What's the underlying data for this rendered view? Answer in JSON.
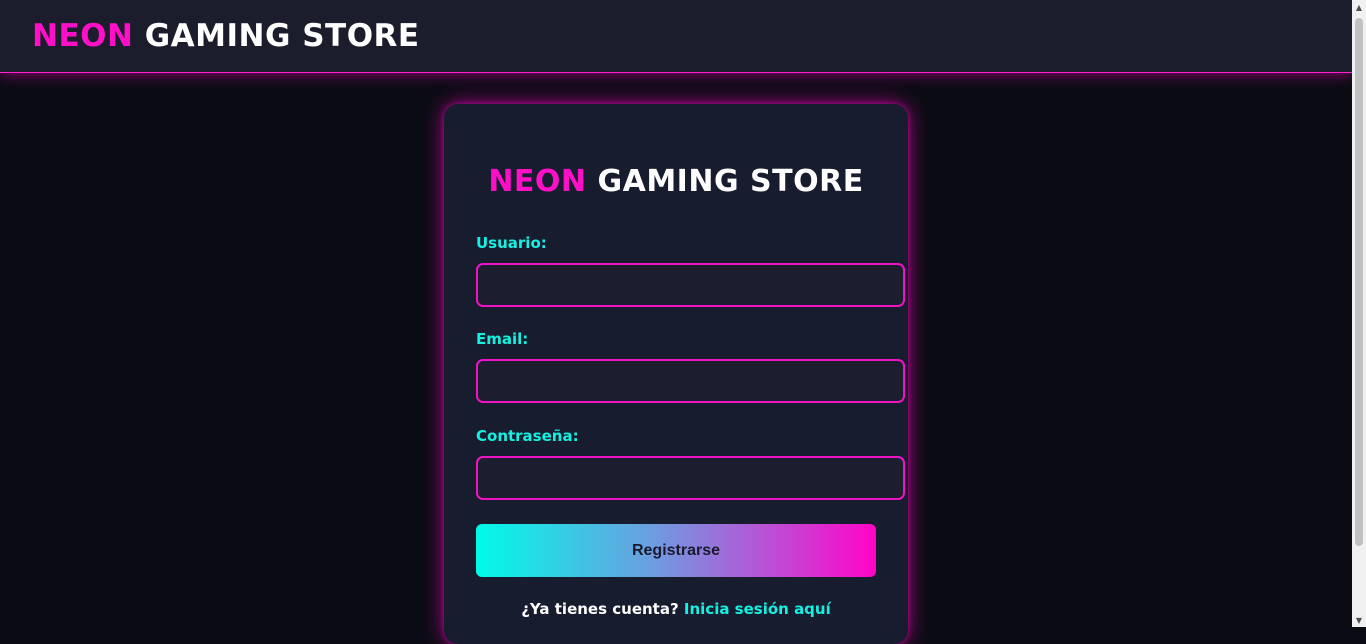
{
  "header": {
    "logo_accent": "NEON",
    "logo_rest": "GAMING STORE"
  },
  "card": {
    "title_accent": "NEON",
    "title_rest": "GAMING STORE",
    "fields": {
      "username": {
        "label": "Usuario:",
        "value": "",
        "placeholder": ""
      },
      "email": {
        "label": "Email:",
        "value": "",
        "placeholder": ""
      },
      "password": {
        "label": "Contraseña:",
        "value": "",
        "placeholder": ""
      }
    },
    "submit_label": "Registrarse",
    "login_prompt": "¿Ya tienes cuenta?",
    "login_link": "Inicia sesión aquí"
  },
  "colors": {
    "accent_pink": "#ff10c8",
    "accent_cyan": "#15f0e0",
    "background": "#0b0c13",
    "card": "#181c2f"
  },
  "icons": {
    "scroll_up": "triangle-up",
    "scroll_down": "triangle-down"
  }
}
